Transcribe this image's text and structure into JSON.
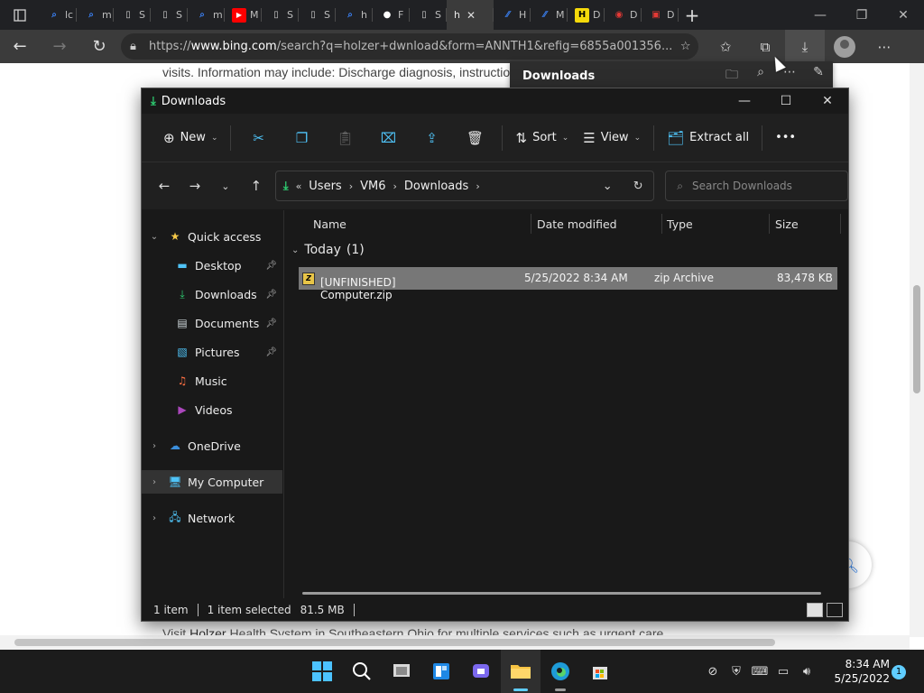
{
  "browser": {
    "tabs": [
      {
        "icon": "search-icon",
        "label": "lc",
        "color": "#3b82f6"
      },
      {
        "icon": "search-icon",
        "label": "m",
        "color": "#3b82f6"
      },
      {
        "icon": "page-icon",
        "label": "S",
        "color": "#cfcfcf"
      },
      {
        "icon": "page-icon",
        "label": "S",
        "color": "#cfcfcf"
      },
      {
        "icon": "search-icon",
        "label": "m",
        "color": "#3b82f6"
      },
      {
        "icon": "youtube-icon",
        "label": "M",
        "color": "#ff0000"
      },
      {
        "icon": "page-icon",
        "label": "S",
        "color": "#cfcfcf"
      },
      {
        "icon": "page-icon",
        "label": "S",
        "color": "#cfcfcf"
      },
      {
        "icon": "search-icon",
        "label": "h",
        "color": "#3b82f6"
      },
      {
        "icon": "github-icon",
        "label": "F",
        "color": "#ffffff"
      },
      {
        "icon": "page-icon",
        "label": "S",
        "color": "#cfcfcf"
      }
    ],
    "active_tab": {
      "label": "h",
      "close": "✕"
    },
    "tabs_after": [
      {
        "icon": "app-icon",
        "label": "H",
        "color": "#3b82f6"
      },
      {
        "icon": "app-icon",
        "label": "M",
        "color": "#3b82f6"
      },
      {
        "icon": "h-logo-icon",
        "label": "D",
        "color": "#f5d90a"
      },
      {
        "icon": "globe-icon",
        "label": "D",
        "color": "#e53935"
      },
      {
        "icon": "flag-icon",
        "label": "D",
        "color": "#e53935"
      }
    ],
    "url_prefix": "https://",
    "url_host": "www.bing.com",
    "url_rest": "/search?q=holzer+dwnload&form=ANNTH1&refig=6855a001356...",
    "page_text_top": "visits. Information may include: Discharge diagnosis, instructio",
    "page_text_bottom_a": "Visit ",
    "page_text_bottom_b": "Holzer",
    "page_text_bottom_c": " Health System in Southeastern Ohio for multiple services such as urgent care"
  },
  "downloads_flyout": {
    "title": "Downloads"
  },
  "explorer": {
    "title": "Downloads",
    "toolbar": {
      "new_label": "New",
      "sort_label": "Sort",
      "view_label": "View",
      "extract_label": "Extract all",
      "more_label": "•••"
    },
    "breadcrumb": {
      "overflow": "«",
      "items": [
        "Users",
        "VM6",
        "Downloads"
      ]
    },
    "search_placeholder": "Search Downloads",
    "nav": {
      "quick_access": "Quick access",
      "items": [
        {
          "label": "Desktop",
          "pinned": true
        },
        {
          "label": "Downloads",
          "pinned": true
        },
        {
          "label": "Documents",
          "pinned": true
        },
        {
          "label": "Pictures",
          "pinned": true
        },
        {
          "label": "Music",
          "pinned": false
        },
        {
          "label": "Videos",
          "pinned": false
        }
      ],
      "onedrive": "OneDrive",
      "my_computer": "My Computer",
      "network": "Network"
    },
    "columns": {
      "name": "Name",
      "date": "Date modified",
      "type": "Type",
      "size": "Size"
    },
    "group": {
      "label": "Today",
      "count": "(1)"
    },
    "files": [
      {
        "name": "[UNFINISHED] Computer.zip",
        "date": "5/25/2022 8:34 AM",
        "type": "zip Archive",
        "size": "83,478 KB"
      }
    ],
    "status": {
      "count": "1 item",
      "selected": "1 item selected",
      "size": "81.5 MB"
    }
  },
  "taskbar": {
    "time": "8:34 AM",
    "date": "5/25/2022",
    "notifications": "1"
  }
}
